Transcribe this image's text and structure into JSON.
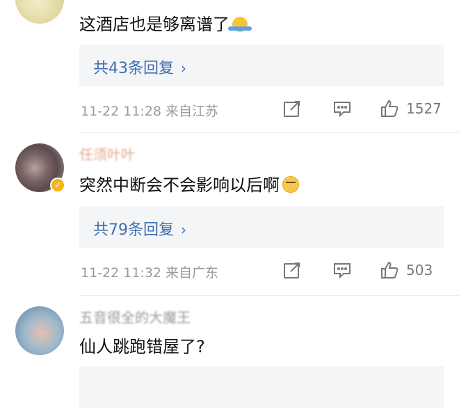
{
  "comments": [
    {
      "username": "",
      "text": "这酒店也是够离谱了",
      "emoji": "shrug-emoji",
      "replies": "共43条回复",
      "meta": "11-22 11:28 来自江苏",
      "likes": "1527"
    },
    {
      "username": "任须叶叶",
      "text": "突然中断会不会影响以后啊",
      "emoji": "sweat-face-emoji",
      "replies": "共79条回复",
      "meta": "11-22 11:32 来自广东",
      "likes": "503",
      "verified": true
    },
    {
      "username": "五音很全的大魔王",
      "text": "仙人跳跑错屋了?",
      "replies": ""
    }
  ],
  "colors": {
    "link": "#3e6fb1",
    "meta": "#9a9a9a",
    "verified": "#f3b41b"
  }
}
